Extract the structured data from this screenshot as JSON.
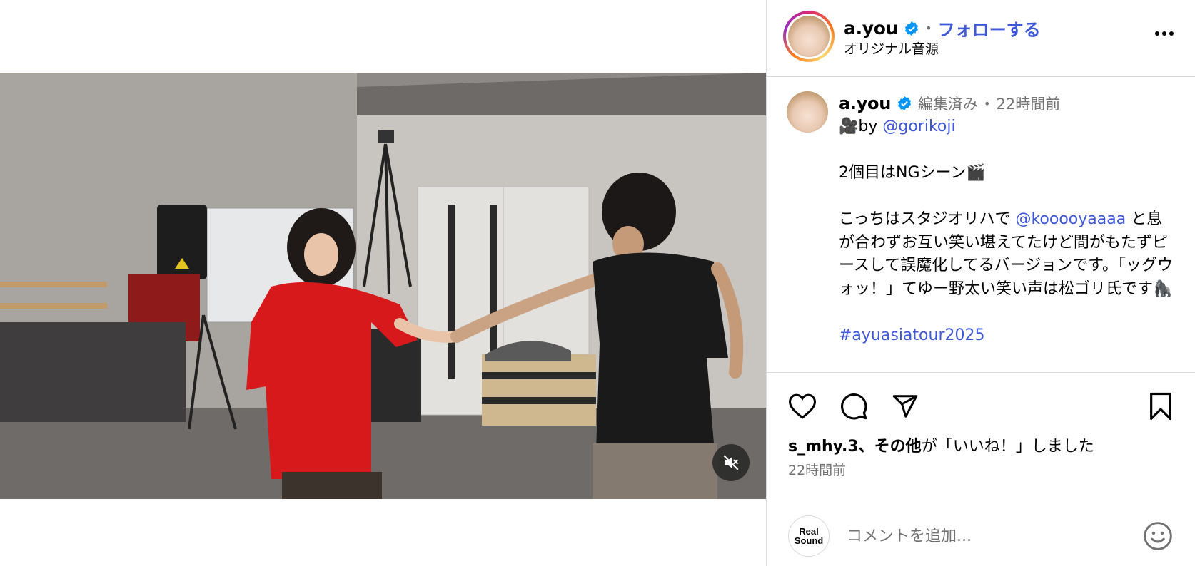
{
  "header": {
    "username": "a.you",
    "separator": "•",
    "follow_label": "フォローする",
    "audio_label": "オリジナル音源"
  },
  "caption": {
    "username": "a.you",
    "edited": "編集済み",
    "separator": "•",
    "time": "22時間前",
    "line1_prefix": "🎥by ",
    "line1_mention": "@gorikoji",
    "line2": "2個目はNGシーン🎬",
    "line3_prefix": "こっちはスタジオリハで ",
    "line3_mention": "@kooooyaaaa",
    "line3_suffix": " と息が合わずお互い笑い堪えてたけど間がもたずピースして誤魔化してるバージョンです。「ッグウォッ！」てゆー野太い笑い声は松ゴリ氏です🦍",
    "hashtag": "#ayuasiatour2025"
  },
  "likes": {
    "liker": "s_mhy.3",
    "rest_bold": "、その他",
    "text": "が「いいね！」しました"
  },
  "posted_time": "22時間前",
  "comment": {
    "avatar_text_1": "Real",
    "avatar_text_2": "Sound",
    "placeholder": "コメントを追加..."
  },
  "icons": {
    "verified": "verified-badge-icon",
    "more": "more-options-icon",
    "like": "heart-icon",
    "comment": "comment-icon",
    "share": "share-icon",
    "save": "bookmark-icon",
    "mute": "muted-speaker-icon",
    "emoji": "emoji-icon"
  },
  "colors": {
    "link": "#3f58d6",
    "verified": "#0095f6",
    "secondary_text": "#737373",
    "divider": "#dbdbdb"
  }
}
